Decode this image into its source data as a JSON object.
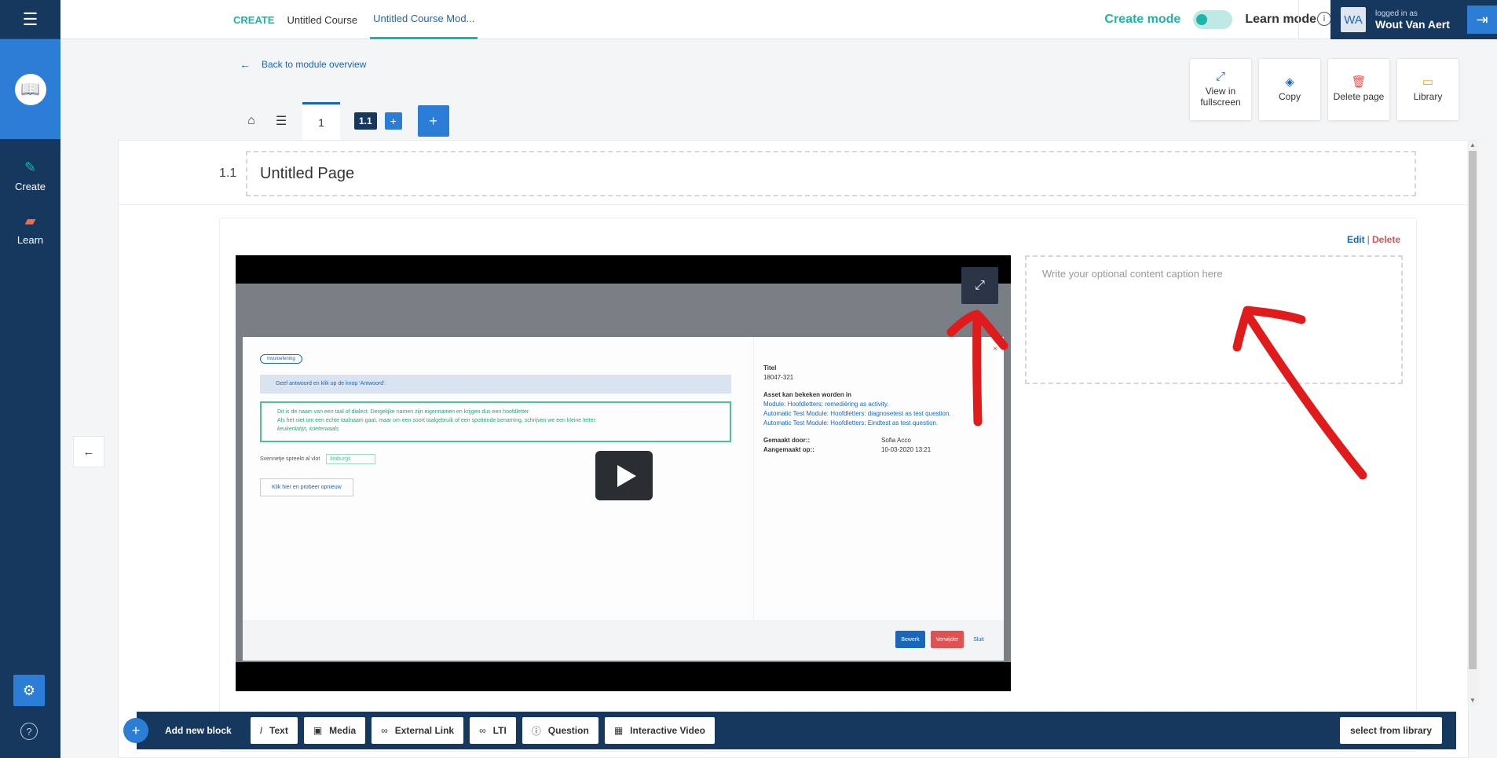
{
  "sidebar": {
    "items": [
      {
        "label": "Create",
        "icon": "pencil-icon"
      },
      {
        "label": "Learn",
        "icon": "eraser-icon"
      }
    ]
  },
  "topbar": {
    "breadcrumb": {
      "create": "CREATE",
      "course": "Untitled Course",
      "module": "Untitled Course Mod..."
    },
    "create_mode": "Create mode",
    "learn_mode": "Learn mode",
    "user": {
      "initials": "WA",
      "logged_in_as": "logged in as",
      "name": "Wout Van Aert"
    }
  },
  "back_link": "Back to module overview",
  "tools": {
    "fullscreen": "View in fullscreen",
    "copy": "Copy",
    "delete_page": "Delete page",
    "library": "Library"
  },
  "tabs": {
    "page": "1",
    "current": "1.1",
    "add": "+",
    "add_page": "+"
  },
  "page": {
    "number": "1.1",
    "title": "Untitled Page"
  },
  "block": {
    "edit": "Edit",
    "sep": "|",
    "delete": "Delete",
    "caption_placeholder": "Write your optional content caption here"
  },
  "video": {
    "pill": "Invuloefening",
    "info": "Geef antwoord en klik op de knop 'Antwoord'.",
    "green_1": "Dit is de naam van een taal of dialect. Dergelijke namen zijn eigennamen en krijgen dus een hoofdletter.",
    "green_2": "Als het niet om een echte taalnaam gaat, maar om een soort taalgebruik of een spottende benaming, schrijven we een kleine letter:",
    "green_3": "keukenlatijn, koeterwaals",
    "line": "Svennetje spreekt al vlot",
    "line_value": "limburgs",
    "retry": "Klik hier en probeer opnieuw",
    "titel_label": "Titel",
    "titel_value": "18047-321",
    "asset_label": "Asset kan bekeken worden in",
    "asset_1": "Module: Hoofdletters: remediëring as activity.",
    "asset_2": "Automatic Test Module: Hoofdletters: diagnosetest as test question.",
    "asset_3": "Automatic Test Module: Hoofdletters: Eindtest as test question.",
    "made_by_label": "Gemaakt door::",
    "made_by_value": "Sofia Acco",
    "created_label": "Aangemaakt op::",
    "created_value": "10-03-2020 13:21",
    "btn_edit": "Bewerk",
    "btn_remove": "Verwijder",
    "btn_close": "Sluit"
  },
  "bottombar": {
    "add_label": "Add new block",
    "buttons": [
      {
        "label": "Text",
        "icon": "italic-icon"
      },
      {
        "label": "Media",
        "icon": "image-icon"
      },
      {
        "label": "External Link",
        "icon": "link-icon"
      },
      {
        "label": "LTI",
        "icon": "link-icon"
      },
      {
        "label": "Question",
        "icon": "info-icon"
      },
      {
        "label": "Interactive Video",
        "icon": "film-icon"
      }
    ],
    "library": "select from library"
  },
  "colors": {
    "navy": "#17385e",
    "blue": "#2b7dd6",
    "teal": "#1bb5a9",
    "red": "#e05151",
    "annotation": "#e01b1b"
  }
}
